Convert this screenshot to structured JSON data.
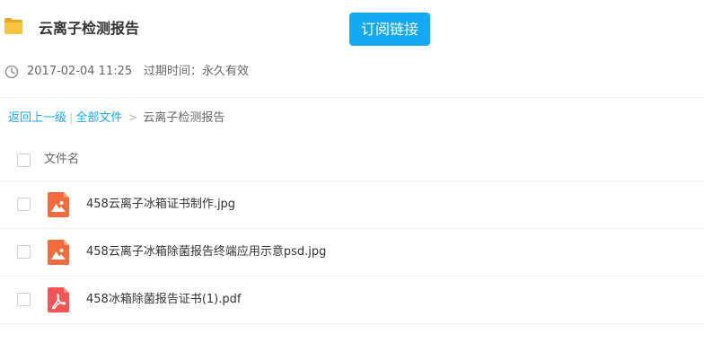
{
  "header": {
    "title": "云离子检测报告",
    "subscribe_label": "订阅链接",
    "date": "2017-02-04 11:25",
    "expiry": "过期时间：永久有效"
  },
  "breadcrumb": {
    "back": "返回上一级",
    "sep_bar": "|",
    "all_files": "全部文件",
    "sep_arrow": ">",
    "current": "云离子检测报告"
  },
  "list": {
    "column_name": "文件名",
    "files": [
      {
        "name": "458云离子冰箱证书制作.jpg",
        "icon": "image-file-icon"
      },
      {
        "name": "458云离子冰箱除菌报告终端应用示意psd.jpg",
        "icon": "image-file-icon"
      },
      {
        "name": "458冰箱除菌报告证书(1).pdf",
        "icon": "pdf-file-icon"
      }
    ]
  },
  "colors": {
    "accent": "#13a9f3",
    "image_icon": "#f26b3a",
    "pdf_icon": "#f25555",
    "folder": "#f5b82e"
  }
}
